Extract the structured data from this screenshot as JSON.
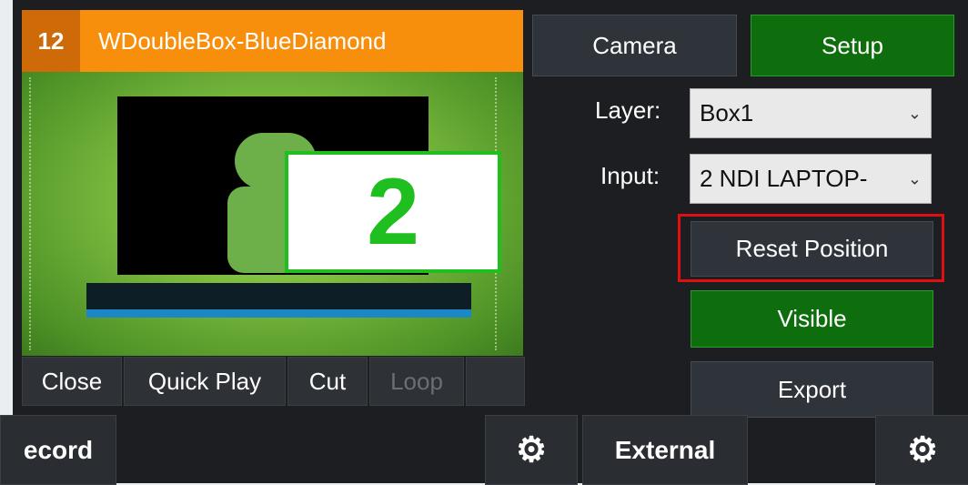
{
  "input_panel": {
    "number": "12",
    "title": "WDoubleBox-BlueDiamond",
    "preview_overlay_number": "2",
    "buttons": {
      "close": "Close",
      "quick_play": "Quick Play",
      "cut": "Cut",
      "loop": "Loop"
    }
  },
  "right_panel": {
    "camera_label": "Camera",
    "setup_label": "Setup",
    "layer_label": "Layer:",
    "layer_value": "Box1",
    "input_label": "Input:",
    "input_value": "2 NDI LAPTOP-",
    "reset_position_label": "Reset Position",
    "visible_label": "Visible",
    "export_label": "Export"
  },
  "footer": {
    "record_label": "ecord",
    "external_label": "External"
  },
  "icons": {
    "gear": "gear-icon",
    "chevron": "chevron-down-icon"
  },
  "colors": {
    "title_bar": "#f88f0c",
    "active_green": "#0e6e0e",
    "highlight_red": "#e01010",
    "overlay_green": "#1fbf1f"
  }
}
